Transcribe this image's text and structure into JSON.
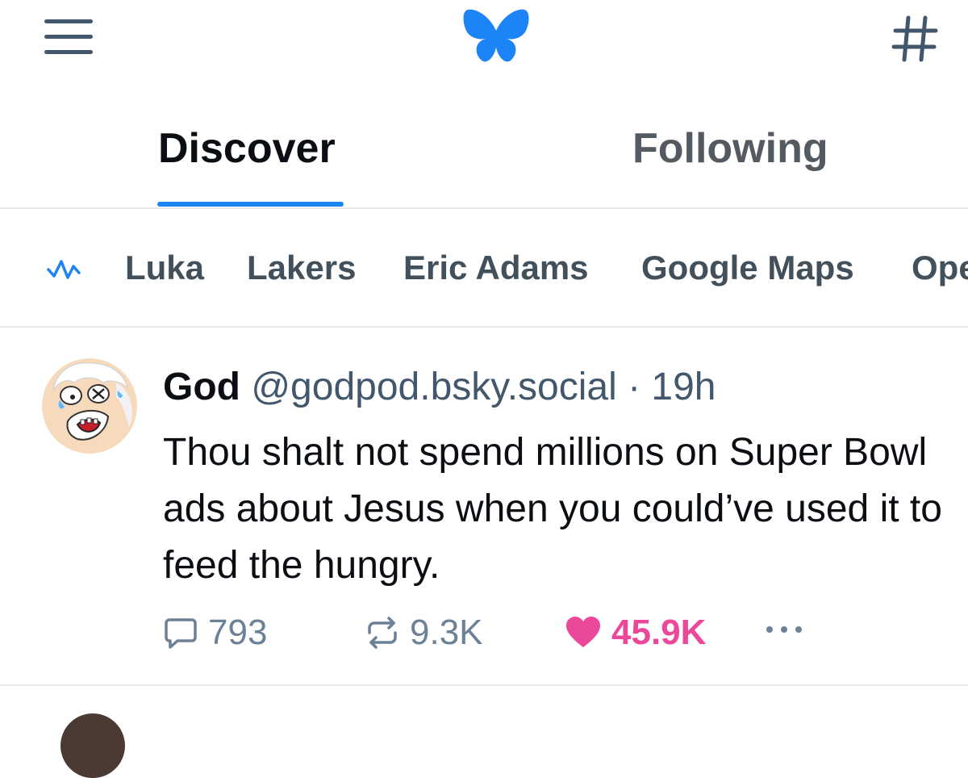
{
  "app": {
    "brand_color": "#1d84f7"
  },
  "header": {
    "icons": [
      "menu-icon",
      "butterfly-logo-icon",
      "hashtag-icon"
    ]
  },
  "tabs": [
    {
      "label": "Discover",
      "selected": true
    },
    {
      "label": "Following",
      "selected": false
    }
  ],
  "trending": {
    "icon": "trending-icon",
    "items": [
      "Luka",
      "Lakers",
      "Eric Adams",
      "Google Maps",
      "Ope"
    ]
  },
  "post": {
    "author": "God",
    "handle": "@godpod.bsky.social",
    "separator": " · ",
    "time": "19h",
    "text": "Thou shalt not spend millions on Super Bowl ads about Jesus when you could’ve used it to feed the hungry.",
    "replies": "793",
    "reposts": "9.3K",
    "likes": "45.9K",
    "liked": true
  },
  "colors": {
    "like": "#ec4899",
    "muted": "#6d8196",
    "handle": "#42576c"
  }
}
